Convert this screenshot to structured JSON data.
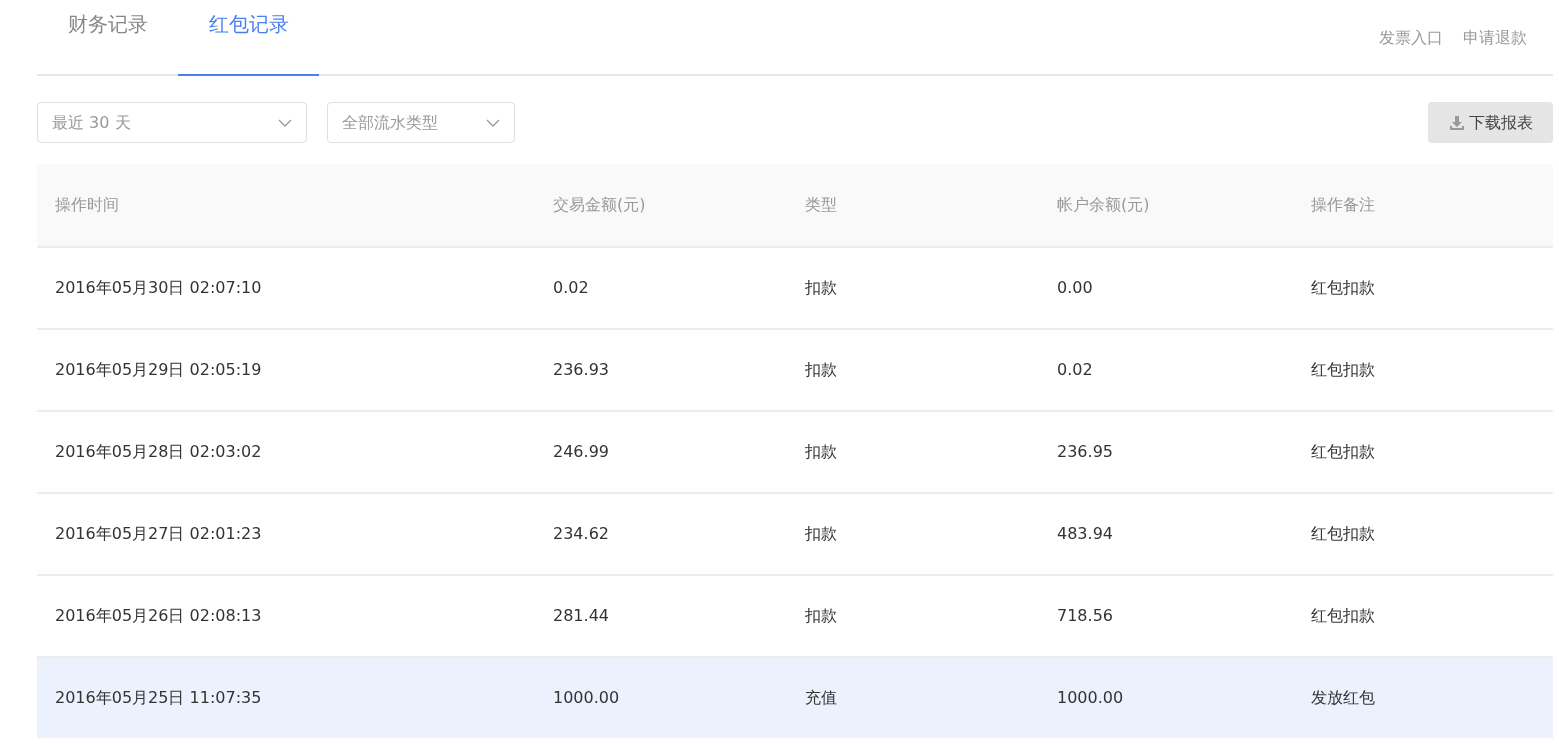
{
  "tabs": [
    {
      "label": "财务记录",
      "selected": false
    },
    {
      "label": "红包记录",
      "selected": true
    }
  ],
  "header_links": [
    "发票入口",
    "申请退款"
  ],
  "filters": [
    {
      "value": "最近 30 天"
    },
    {
      "value": "全部流水类型"
    }
  ],
  "download_button": "下载报表",
  "table": {
    "columns": [
      "操作时间",
      "交易金额(元)",
      "类型",
      "帐户余额(元)",
      "操作备注"
    ],
    "rows": [
      {
        "cells": [
          "2016年05月30日 02:07:10",
          "0.02",
          "扣款",
          "0.00",
          "红包扣款"
        ],
        "selected": false
      },
      {
        "cells": [
          "2016年05月29日 02:05:19",
          "236.93",
          "扣款",
          "0.02",
          "红包扣款"
        ],
        "selected": false
      },
      {
        "cells": [
          "2016年05月28日 02:03:02",
          "246.99",
          "扣款",
          "236.95",
          "红包扣款"
        ],
        "selected": false
      },
      {
        "cells": [
          "2016年05月27日 02:01:23",
          "234.62",
          "扣款",
          "483.94",
          "红包扣款"
        ],
        "selected": false
      },
      {
        "cells": [
          "2016年05月26日 02:08:13",
          "281.44",
          "扣款",
          "718.56",
          "红包扣款"
        ],
        "selected": false
      },
      {
        "cells": [
          "2016年05月25日 11:07:35",
          "1000.00",
          "充值",
          "1000.00",
          "发放红包"
        ],
        "selected": true
      }
    ]
  }
}
